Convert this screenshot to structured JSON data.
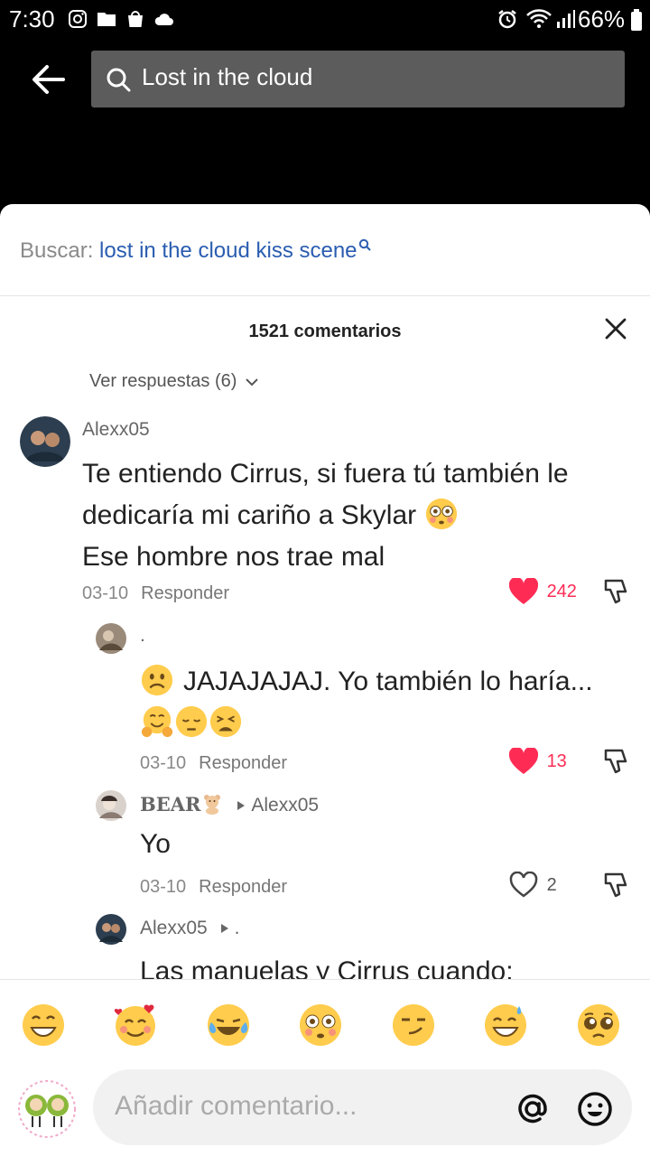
{
  "status_bar": {
    "time": "7:30",
    "battery": "66%"
  },
  "header": {
    "search_query": "Lost in the cloud"
  },
  "suggestion": {
    "prefix": "Buscar:",
    "link": "lost in the cloud kiss scene"
  },
  "comments_panel": {
    "count_label": "1521 comentarios",
    "view_replies": "Ver respuestas (6)",
    "reply_label": "Responder",
    "comments": [
      {
        "user": "Alexx05",
        "line1": "Te entiendo Cirrus, si fuera tú también le",
        "line2": "dedicaría mi cariño a Skylar",
        "line3": "Ese hombre nos trae mal",
        "date": "03-10",
        "likes": "242"
      },
      {
        "user": ".",
        "text": "JAJAJAJAJ. Yo también lo haría...",
        "date": "03-10",
        "likes": "13"
      },
      {
        "user": "BEAR",
        "reply_to": "Alexx05",
        "text": "Yo",
        "date": "03-10",
        "likes": "2"
      },
      {
        "user": "Alexx05",
        "reply_to": ".",
        "text": "Las manuelas y Cirrus cuando:"
      }
    ]
  },
  "emoji_bar": [
    "grin",
    "smiling-hearts",
    "joy",
    "flushed",
    "smirk",
    "sweat-smile",
    "pleading"
  ],
  "composer": {
    "placeholder": "Añadir comentario..."
  },
  "colors": {
    "like_red": "#fe2c55",
    "link_blue": "#2a5db0"
  }
}
